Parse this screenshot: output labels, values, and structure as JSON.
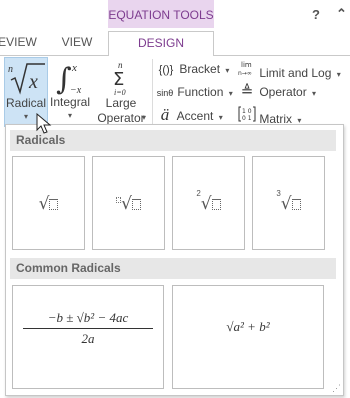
{
  "tabs": {
    "context_header": "EQUATION TOOLS",
    "review": "EVIEW",
    "view": "VIEW",
    "design": "DESIGN",
    "help": "?",
    "collapse": "⌃"
  },
  "ribbon": {
    "radical": {
      "label": "Radical",
      "glyph": "ⁿ√x"
    },
    "integral": {
      "label": "Integral"
    },
    "large_operator": {
      "label_line1": "Large",
      "label_line2": "Operator"
    },
    "bracket": {
      "label": "Bracket",
      "icon": "{()}"
    },
    "function": {
      "label": "Function",
      "icon": "sinθ"
    },
    "accent": {
      "label": "Accent",
      "icon": "ä"
    },
    "limit_and_log": {
      "label": "Limit and Log",
      "icon": "lim n→∞"
    },
    "operator": {
      "label": "Operator",
      "icon": "≜"
    },
    "matrix": {
      "label": "Matrix",
      "icon": "[10 01]"
    }
  },
  "gallery": {
    "radicals_header": "Radicals",
    "common_radicals_header": "Common Radicals",
    "radicals": [
      {
        "name": "square root",
        "index": ""
      },
      {
        "name": "radical with degree",
        "index": "box"
      },
      {
        "name": "square root with degree",
        "index": "2"
      },
      {
        "name": "cube root",
        "index": "3"
      }
    ],
    "common_radicals": {
      "quadratic_numerator": "−b ± √b² − 4ac",
      "quadratic_denominator": "2a",
      "pythagoras": "√a² + b²"
    }
  },
  "colors": {
    "accent_purple": "#7d3c8f",
    "context_bg": "#e9d5ee",
    "selected_bg": "#cde3f5"
  }
}
